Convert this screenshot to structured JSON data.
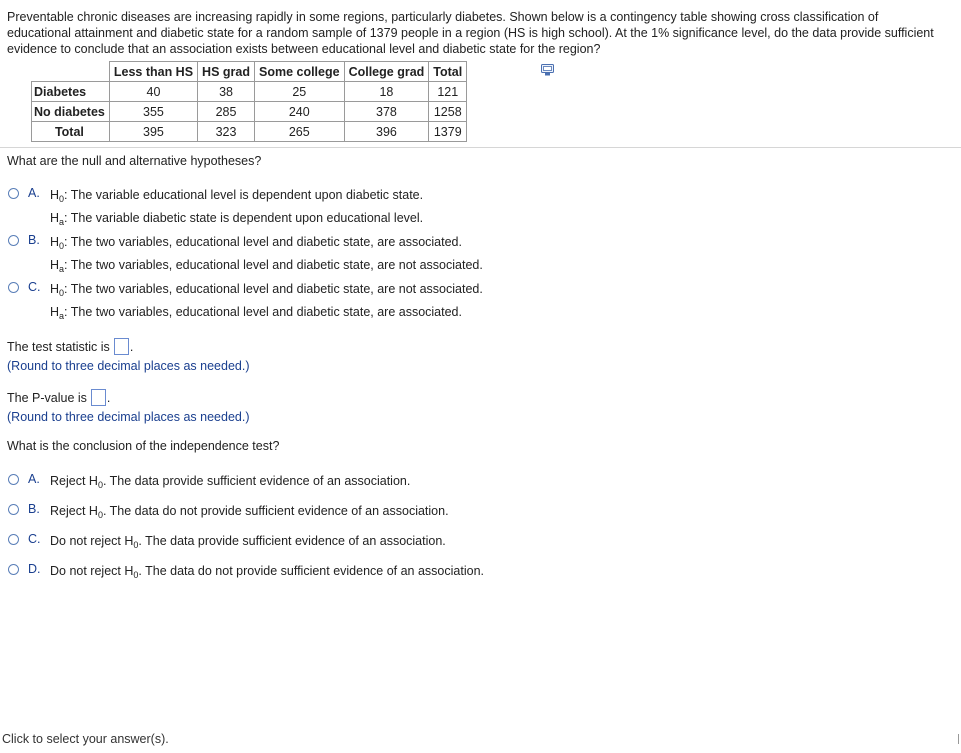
{
  "intro": "Preventable chronic diseases are increasing rapidly in some regions, particularly diabetes. Shown below is a contingency table showing cross classification of educational attainment and diabetic state for a random sample of 1379 people in a region (HS is high school). At the 1% significance level, do the data provide sufficient evidence to conclude that an association exists between educational level and diabetic state for the region?",
  "table": {
    "headers": [
      "Less than HS",
      "HS grad",
      "Some college",
      "College grad",
      "Total"
    ],
    "rows": [
      {
        "label": "Diabetes",
        "cells": [
          "40",
          "38",
          "25",
          "18",
          "121"
        ]
      },
      {
        "label": "No diabetes",
        "cells": [
          "355",
          "285",
          "240",
          "378",
          "1258"
        ]
      },
      {
        "label": "Total",
        "cells": [
          "395",
          "323",
          "265",
          "396",
          "1379"
        ]
      }
    ]
  },
  "q1": {
    "question": "What are the null and alternative hypotheses?",
    "options": [
      {
        "letter": "A.",
        "h0": "The variable educational level is dependent upon diabetic state.",
        "ha": "The variable diabetic state is dependent upon educational level."
      },
      {
        "letter": "B.",
        "h0": "The two variables, educational level and diabetic state, are associated.",
        "ha": "The two variables, educational level and diabetic state, are not associated."
      },
      {
        "letter": "C.",
        "h0": "The two variables, educational level and diabetic state, are not associated.",
        "ha": "The two variables, educational level and diabetic state, are associated."
      }
    ]
  },
  "labels": {
    "h0": "H",
    "h0_sub": "0",
    "ha": "H",
    "ha_sub": "a"
  },
  "test_statistic": {
    "label": "The test statistic is",
    "hint": "(Round to three decimal places as needed.)"
  },
  "p_value": {
    "label": "The P-value is",
    "hint": "(Round to three decimal places as needed.)"
  },
  "q2": {
    "question": "What is the conclusion of the independence test?",
    "options": [
      {
        "letter": "A.",
        "prefix": "Reject H",
        "sub": "0",
        "text": ". The data provide sufficient evidence of an association."
      },
      {
        "letter": "B.",
        "prefix": "Reject H",
        "sub": "0",
        "text": ". The data do not provide sufficient evidence of an association."
      },
      {
        "letter": "C.",
        "prefix": "Do not reject H",
        "sub": "0",
        "text": ". The data provide sufficient evidence of an association."
      },
      {
        "letter": "D.",
        "prefix": "Do not reject H",
        "sub": "0",
        "text": ". The data do not provide sufficient evidence of an association."
      }
    ]
  },
  "footer": "Click to select your answer(s).",
  "icons": {
    "copy": "copy-table-icon",
    "radio": "radio-button"
  },
  "colors": {
    "accent": "#1a3f8f",
    "radio_border": "#5a7fb8"
  }
}
